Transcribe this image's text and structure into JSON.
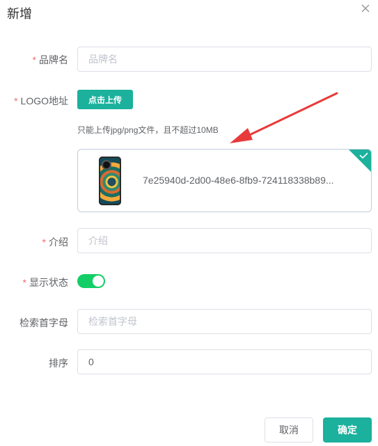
{
  "dialog": {
    "title": "新增",
    "close_icon": "close-icon"
  },
  "form": {
    "required_mark": "*",
    "brand_name": {
      "label": "品牌名",
      "placeholder": "品牌名",
      "value": ""
    },
    "logo": {
      "label": "LOGO地址",
      "upload_button": "点击上传",
      "tip": "只能上传jpg/png文件，且不超过10MB",
      "file_name": "7e25940d-2d00-48e6-8fb9-724118338b89...",
      "success_icon": "check-icon"
    },
    "intro": {
      "label": "介绍",
      "placeholder": "介绍",
      "value": ""
    },
    "show_status": {
      "label": "显示状态",
      "enabled": true
    },
    "first_letter": {
      "label": "检索首字母",
      "placeholder": "检索首字母",
      "value": ""
    },
    "sort": {
      "label": "排序",
      "value": "0"
    }
  },
  "footer": {
    "cancel": "取消",
    "confirm": "确定"
  },
  "colors": {
    "primary": "#1bb19c",
    "switch_on": "#13ce66",
    "required": "#f56c6c",
    "annotation_arrow": "#e83a3a"
  }
}
